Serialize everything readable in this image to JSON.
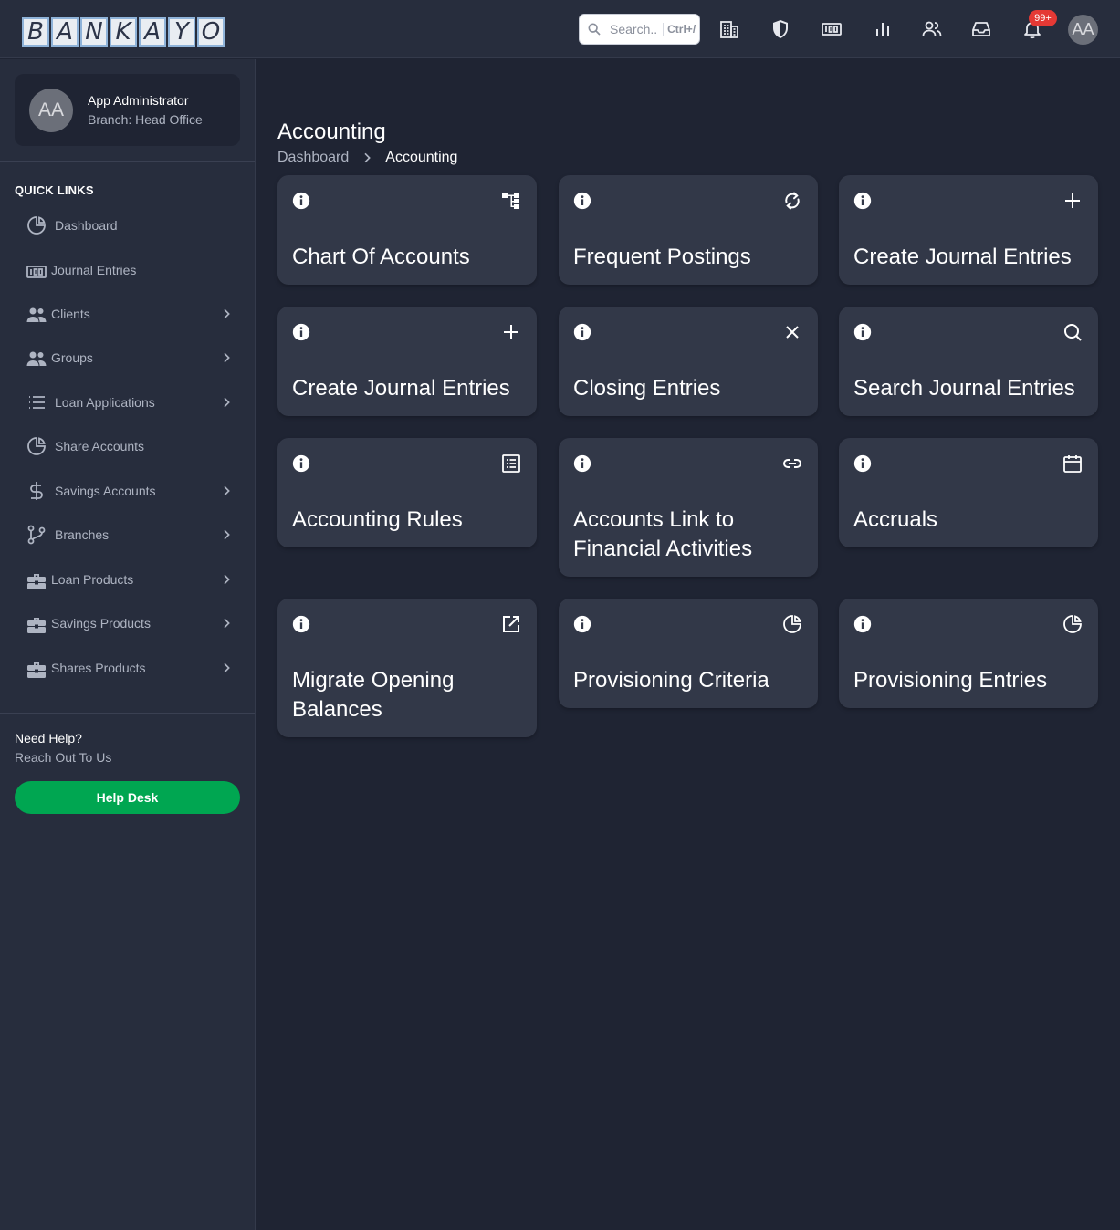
{
  "app": {
    "logo_letters": [
      "B",
      "A",
      "N",
      "K",
      "A",
      "Y",
      "O"
    ],
    "search": {
      "placeholder": "Search..",
      "shortcut": "Ctrl+/"
    },
    "notifications_badge": "99+",
    "user_initials": "AA"
  },
  "toolbar_icons": [
    "building-icon",
    "shield-icon",
    "counter-icon",
    "bar-chart-icon",
    "users-icon",
    "inbox-icon",
    "bell-icon"
  ],
  "sidebar": {
    "profile": {
      "initials": "AA",
      "name": "App Administrator",
      "branch": "Branch: Head Office"
    },
    "section_title": "QUICK LINKS",
    "items": [
      {
        "label": "Dashboard",
        "icon": "pie-chart-icon",
        "chevron": false
      },
      {
        "label": "Journal Entries",
        "icon": "counter-icon",
        "chevron": false
      },
      {
        "label": "Clients",
        "icon": "users-icon",
        "chevron": true
      },
      {
        "label": "Groups",
        "icon": "users-icon",
        "chevron": true
      },
      {
        "label": "Loan Applications",
        "icon": "list-icon",
        "chevron": true
      },
      {
        "label": "Share Accounts",
        "icon": "pie-chart-icon",
        "chevron": false
      },
      {
        "label": "Savings Accounts",
        "icon": "dollar-icon",
        "chevron": true
      },
      {
        "label": "Branches",
        "icon": "git-branch-icon",
        "chevron": true
      },
      {
        "label": "Loan Products",
        "icon": "briefcase-icon",
        "chevron": true
      },
      {
        "label": "Savings Products",
        "icon": "briefcase-icon",
        "chevron": true
      },
      {
        "label": "Shares Products",
        "icon": "briefcase-icon",
        "chevron": true
      }
    ],
    "help": {
      "title": "Need Help?",
      "subtitle": "Reach Out To Us",
      "button": "Help Desk"
    }
  },
  "main": {
    "title": "Accounting",
    "breadcrumb": [
      "Dashboard",
      "Accounting"
    ],
    "cards": [
      {
        "title": "Chart Of Accounts",
        "icon": "hierarchy-icon"
      },
      {
        "title": "Frequent Postings",
        "icon": "refresh-icon"
      },
      {
        "title": "Create Journal Entries",
        "icon": "plus-icon"
      },
      {
        "title": "Create Journal Entries",
        "icon": "plus-icon"
      },
      {
        "title": "Closing Entries",
        "icon": "close-icon"
      },
      {
        "title": "Search Journal Entries",
        "icon": "search-icon"
      },
      {
        "title": "Accounting Rules",
        "icon": "list-box-icon"
      },
      {
        "title": "Accounts Link to Financial Activities",
        "icon": "link-icon"
      },
      {
        "title": "Accruals",
        "icon": "calendar-icon"
      },
      {
        "title": "Migrate Opening Balances",
        "icon": "external-link-icon"
      },
      {
        "title": "Provisioning Criteria",
        "icon": "pie-chart-icon"
      },
      {
        "title": "Provisioning Entries",
        "icon": "pie-chart-icon"
      }
    ]
  }
}
